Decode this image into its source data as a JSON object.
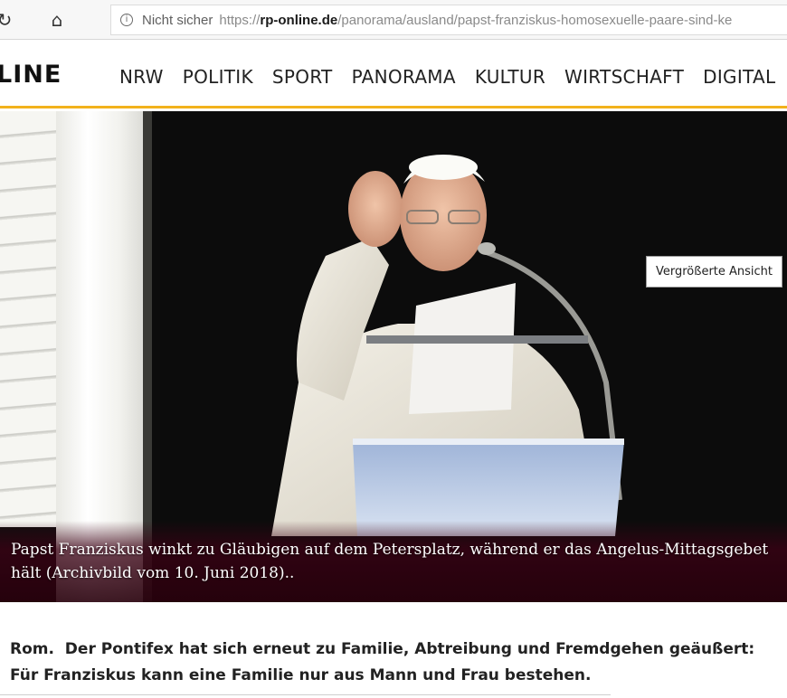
{
  "browser": {
    "reload_icon": "↻",
    "home_icon": "⌂",
    "info_icon": "i",
    "security_label": "Nicht sicher",
    "url_prefix": "https://",
    "url_host": "rp-online.de",
    "url_path": "/panorama/ausland/papst-franziskus-homosexuelle-paare-sind-ke"
  },
  "site": {
    "logo_text": "LINE",
    "accent_color": "#f2b21c",
    "nav": [
      "NRW",
      "POLITIK",
      "SPORT",
      "PANORAMA",
      "KULTUR",
      "WIRTSCHAFT",
      "DIGITAL"
    ]
  },
  "hero": {
    "caption": "Papst Franziskus winkt zu Gläubigen auf dem Petersplatz, während er das Angelus-Mittagsgebet hält (Archivbild vom 10. Juni 2018)..",
    "tooltip": "Vergrößerte Ansicht"
  },
  "article": {
    "dateline": "Rom.",
    "lead": "Der Pontifex hat sich erneut zu Familie, Abtreibung und Fremdgehen geäußert: Für Franziskus kann eine Familie nur aus Mann und Frau bestehen."
  }
}
